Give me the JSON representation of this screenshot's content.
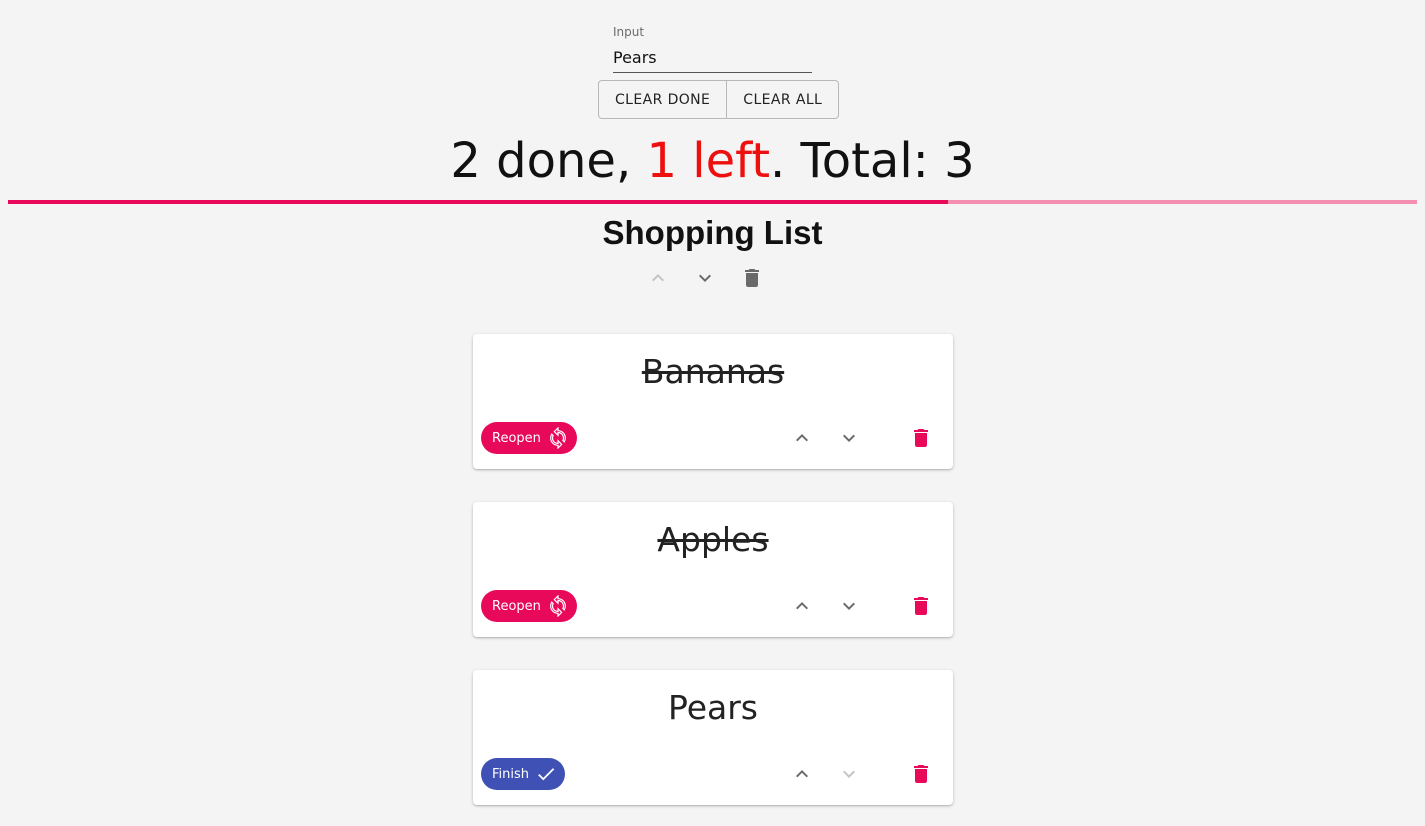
{
  "input": {
    "label": "Input",
    "value": "Pears"
  },
  "actions": {
    "clear_done": "CLEAR DONE",
    "clear_all": "CLEAR ALL"
  },
  "summary": {
    "done_text": "2 done, ",
    "left_text": "1 left",
    "total_text": ". Total: 3"
  },
  "progress": {
    "fraction": 0.667
  },
  "list": {
    "title": "Shopping List"
  },
  "items": [
    {
      "name": "Bananas",
      "done": true,
      "chip_label": "Reopen"
    },
    {
      "name": "Apples",
      "done": true,
      "chip_label": "Reopen"
    },
    {
      "name": "Pears",
      "done": false,
      "chip_label": "Finish"
    }
  ],
  "colors": {
    "accent": "#e8095a",
    "accent_light": "#f48fb1",
    "finish": "#3f51b5",
    "left_red": "#ee0f0f"
  }
}
